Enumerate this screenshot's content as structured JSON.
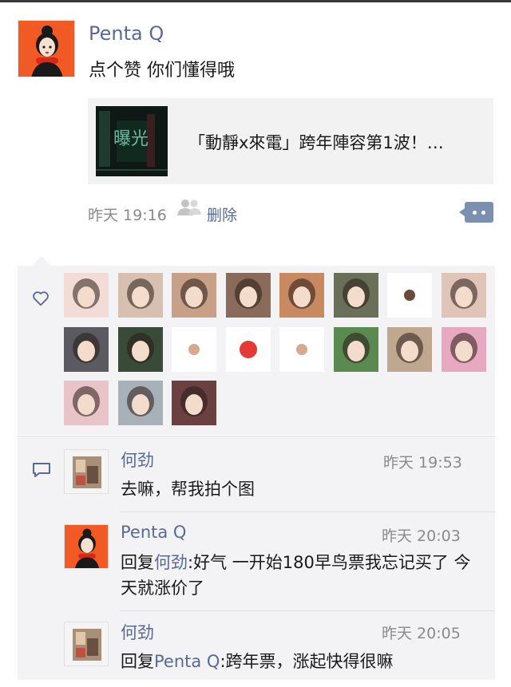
{
  "post": {
    "author": "Penta Q",
    "text": "点个赞 你们懂得哦",
    "link_title": "「動靜x來電」跨年陣容第1波！…",
    "thumb_text": "曝光",
    "time": "昨天 19:16",
    "delete_label": "删除"
  },
  "likes": {
    "avatars": [
      {
        "name": "liker-1",
        "color": "#f4dcd6"
      },
      {
        "name": "liker-2",
        "color": "#d8c0b0"
      },
      {
        "name": "liker-3",
        "color": "#c8a088"
      },
      {
        "name": "liker-4",
        "color": "#8a6a5a"
      },
      {
        "name": "liker-5",
        "color": "#c88860"
      },
      {
        "name": "liker-6",
        "color": "#6a7058"
      },
      {
        "name": "liker-7",
        "color": "#ffffff"
      },
      {
        "name": "liker-8",
        "color": "#e0c4b8"
      },
      {
        "name": "liker-9",
        "color": "#5a5a60"
      },
      {
        "name": "liker-10",
        "color": "#3a4a38"
      },
      {
        "name": "liker-11",
        "color": "#ffffff"
      },
      {
        "name": "liker-12",
        "color": "#ffffff"
      },
      {
        "name": "liker-13",
        "color": "#ffffff"
      },
      {
        "name": "liker-14",
        "color": "#5a8a50"
      },
      {
        "name": "liker-15",
        "color": "#c0a890"
      },
      {
        "name": "liker-16",
        "color": "#e8a8c0"
      },
      {
        "name": "liker-17",
        "color": "#e8c4c8"
      },
      {
        "name": "liker-18",
        "color": "#a8b0b8"
      },
      {
        "name": "liker-19",
        "color": "#6a4040"
      }
    ]
  },
  "comments": [
    {
      "author": "何劲",
      "time": "昨天 19:53",
      "text": "去嘛，帮我拍个图",
      "reply_prefix": "",
      "reply_to": ""
    },
    {
      "author": "Penta Q",
      "time": "昨天 20:03",
      "text": ":好气 一开始180早鸟票我忘记买了 今天就涨价了",
      "reply_prefix": "回复",
      "reply_to": "何劲"
    },
    {
      "author": "何劲",
      "time": "昨天 20:05",
      "text": ":跨年票，涨起快得很嘛",
      "reply_prefix": "回复",
      "reply_to": "Penta Q"
    }
  ],
  "colors": {
    "link_blue": "#576b95",
    "panel_bg": "#f3f3f5",
    "avatar_orange": "#f15a24"
  }
}
